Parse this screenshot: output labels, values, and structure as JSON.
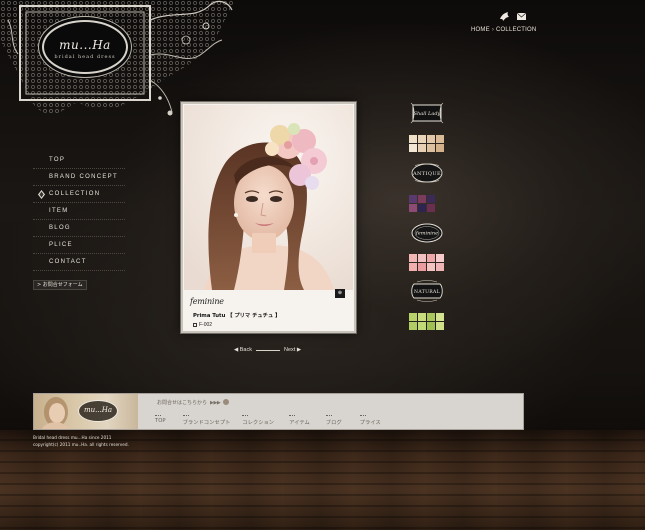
{
  "brand": {
    "logo_text": "mu...Ha",
    "logo_sub": "bridal head dress"
  },
  "header": {
    "icons": [
      "bird-icon",
      "mail-icon"
    ],
    "breadcrumb": [
      "HOME",
      "COLLECTION"
    ],
    "breadcrumb_separator": "›"
  },
  "menu": {
    "items": [
      {
        "label": "TOP"
      },
      {
        "label": "BRAND CONCEPT"
      },
      {
        "label": "COLLECTION",
        "active": true
      },
      {
        "label": "ITEM"
      },
      {
        "label": "BLOG"
      },
      {
        "label": "PLICE"
      },
      {
        "label": "CONTACT"
      }
    ],
    "contact_button": "> お問合せフォーム"
  },
  "product": {
    "brand": "feminine",
    "name": "Prima Tutu 【 プリマ チュチュ 】",
    "code": "F-002",
    "zoom_label": "⊕"
  },
  "pager": {
    "back": "◀ Back",
    "next": "Next ▶"
  },
  "collections": [
    {
      "name": "Shall Lady",
      "swatches": [
        "#efe0c8",
        "#e9d4ba",
        "#e2c8a8",
        "#d9bb98",
        "#f3e6d2",
        "#e7d0b3",
        "#ddc19f",
        "#d2b18b"
      ]
    },
    {
      "name": "ANTIQUE",
      "swatches": [
        "#5a3a6e",
        "#7b3b5a",
        "#3b2a56",
        "#8d4a74",
        "#2e2450",
        "#6a2f4f"
      ]
    },
    {
      "name": "feminine",
      "swatches": [
        "#f2b7b5",
        "#f0c1c0",
        "#eea8a9",
        "#f5cccb",
        "#f1b0ae",
        "#eb9c9f",
        "#f4c3c1",
        "#eeb4b6"
      ]
    },
    {
      "name": "NATURAL",
      "swatches": [
        "#b8d26a",
        "#c9dd7f",
        "#a9c85c",
        "#d4e38f",
        "#b0cc63",
        "#c2d977",
        "#9fc152",
        "#cfe088"
      ]
    }
  ],
  "footer": {
    "contact_text": "お問合せはこちらから",
    "contact_arrows": "▶ ▶ ▶",
    "links": [
      "TOP",
      "ブランドコンセプト",
      "コレクション",
      "アイテム",
      "ブログ",
      "プライス"
    ]
  },
  "copyright": {
    "line1": "Bridal head dress mu...Ha since 2011",
    "line2": "copyright(c) 2011 mu..Ha. all rights reserved."
  },
  "colors": {
    "background": "#1b1714",
    "footer_bg": "#d8d4cf",
    "accent_text": "#e8e2d6"
  }
}
